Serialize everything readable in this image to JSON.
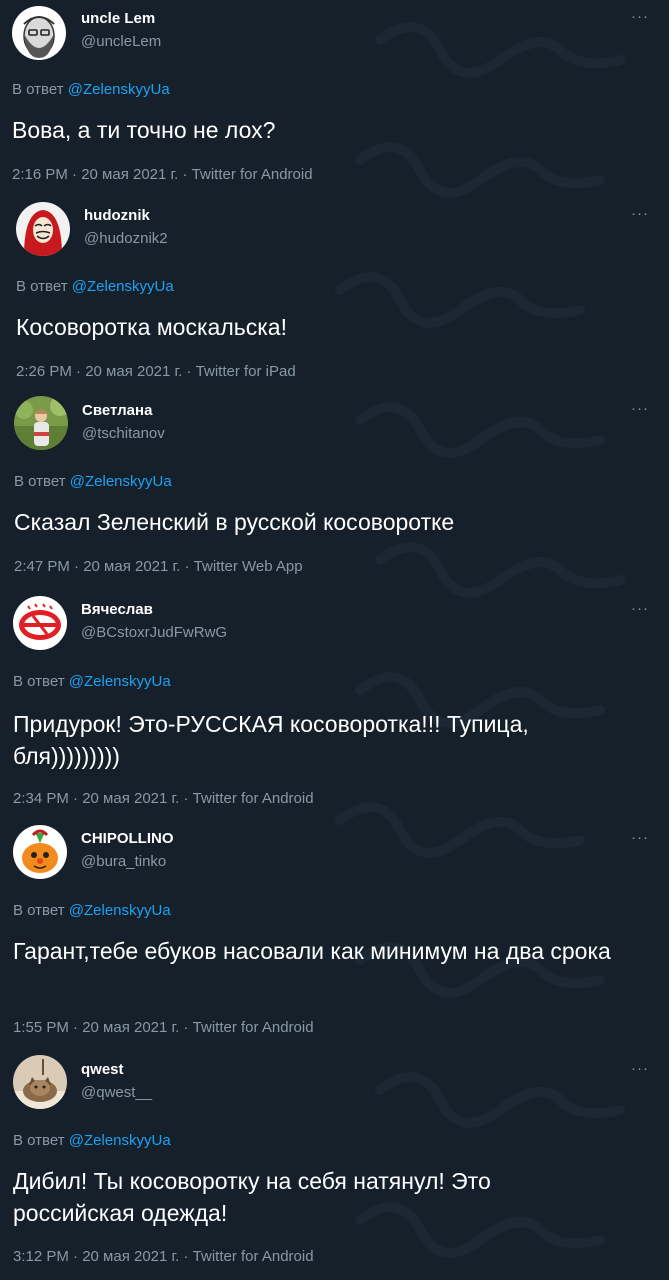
{
  "tweets": [
    {
      "name": "uncle Lem",
      "handle": "@uncleLem",
      "reply_prefix": "В ответ",
      "reply_to": "@ZelenskyyUa",
      "text": "Вова, а ти точно не лох?",
      "meta": "2:16 PM · 20 мая 2021 г. · Twitter for Android",
      "avatar": "bearded-man-avatar"
    },
    {
      "name": "hudoznik",
      "handle": "@hudoznik2",
      "reply_prefix": "В ответ",
      "reply_to": "@ZelenskyyUa",
      "text": "Косоворотка москальска!",
      "meta": "2:26 PM · 20 мая 2021 г. · Twitter for iPad",
      "avatar": "red-hood-mask-avatar"
    },
    {
      "name": "Светлана",
      "handle": "@tschitanov",
      "reply_prefix": "В ответ",
      "reply_to": "@ZelenskyyUa",
      "text": "Сказал Зеленский в русской косоворотке",
      "meta": "2:47 PM · 20 мая 2021 г. · Twitter Web App",
      "avatar": "woman-outdoors-avatar"
    },
    {
      "name": "Вячеслав",
      "handle": "@BCstoxrJudFwRwG",
      "reply_prefix": "В ответ",
      "reply_to": "@ZelenskyyUa",
      "text": "Придурок! Это-РУССКАЯ косоворотка!!! Тупица, бля)))))))))",
      "meta": "2:34 PM · 20 мая 2021 г. · Twitter for Android",
      "avatar": "spartak-logo-avatar"
    },
    {
      "name": "CHIPOLLINO",
      "handle": "@bura_tinko",
      "reply_prefix": "В ответ",
      "reply_to": "@ZelenskyyUa",
      "text": "Гарант,тебе ебуков насовали как минимум на два срока",
      "meta": "1:55 PM · 20 мая 2021 г. · Twitter for Android",
      "avatar": "onion-cartoon-avatar"
    },
    {
      "name": "qwest",
      "handle": "@qwest__",
      "reply_prefix": "В ответ",
      "reply_to": "@ZelenskyyUa",
      "text": "Дибил! Ты косоворотку на себя натянул! Это российская одежда!",
      "meta": "3:12 PM · 20 мая 2021 г. · Twitter for Android",
      "avatar": "cat-photo-avatar"
    }
  ],
  "more_label": "···",
  "colors": {
    "background": "#15202b",
    "secondary_text": "#8899a6",
    "link": "#1da1f2"
  }
}
